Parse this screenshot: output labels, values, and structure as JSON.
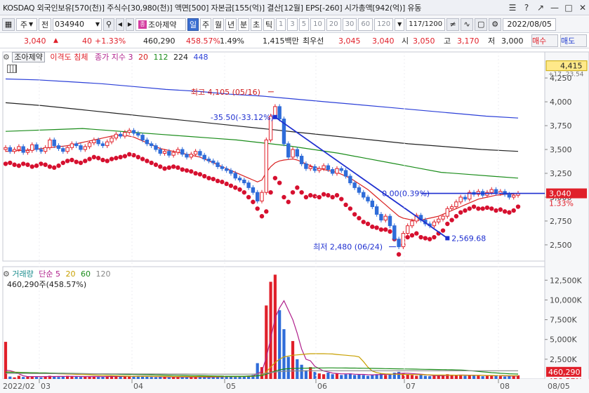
{
  "titlebar": {
    "info": "KOSDAQ 외국인보유[570(천)] 주식수[30,980(천)] 액면[500] 자본금[155(억)] 결산[12월] EPS[-260] 시가총액[942(억)] 유동",
    "icons": [
      "menu-icon",
      "help-icon",
      "popout-icon",
      "minimize-icon",
      "restore-icon",
      "close-icon"
    ]
  },
  "toolbar": {
    "market": "주",
    "scope": "전",
    "code": "034940",
    "name_badge": "종",
    "name": "조아제약",
    "periods": [
      "일",
      "주",
      "월",
      "년",
      "분",
      "초",
      "틱"
    ],
    "selected_period": "일",
    "intervals": [
      "1",
      "3",
      "5",
      "10",
      "20",
      "30",
      "60",
      "120"
    ],
    "count": "117/1200",
    "date": "2022/08/05"
  },
  "quote": {
    "price": "3,040",
    "change": "40",
    "change_pct": "+1.33%",
    "volume": "460,290",
    "volume_ratio": "458.57%",
    "turnover": "1.49%",
    "amount": "1,415백만",
    "priority_label": "최우선",
    "ask": "3,045",
    "bid": "3,040",
    "open_label": "시",
    "open": "3,050",
    "high_label": "고",
    "high": "3,170",
    "low_label": "저",
    "low": "3,000",
    "buy_label": "매수",
    "sell_label": "매도"
  },
  "price_panel": {
    "legend_name": "조아제약",
    "legend_indicator": "이격도 침체",
    "legend_ma": "종가 지수 3",
    "legend_ma_periods": [
      "20",
      "112",
      "224",
      "448"
    ],
    "top_price_tag": "4,415",
    "top_small_tag": "+17, 23.54",
    "yticks": [
      "4,250",
      "4,000",
      "3,750",
      "3,500",
      "3,250",
      "3,000",
      "2,750",
      "2,500"
    ],
    "current_price_tag": "3,040",
    "current_pct_tag": "1.33%",
    "ann_high": "최고 4,105 (05/16)",
    "ann_trend": "-35.50(-33.12%)",
    "ann_level": "0.00(0.39%)",
    "ann_low": "최저 2,480 (06/24)",
    "ann_target": "2,569.68"
  },
  "volume_panel": {
    "legend_name": "거래량",
    "legend_ma": "단순 5",
    "legend_ma_periods": [
      "20",
      "60",
      "120"
    ],
    "current_volume": "460,290주(458.57%)",
    "yticks": [
      "12,500K",
      "10,000K",
      "7,500K",
      "5,000K",
      "2,500K"
    ],
    "current_volume_tag": "460,290",
    "current_pct_tag": "458.57%"
  },
  "xaxis": {
    "labels": [
      "2022/02",
      "03",
      "04",
      "05",
      "06",
      "07",
      "08",
      "08/05"
    ]
  },
  "colors": {
    "up": "#e0202a",
    "down": "#2f6cd9",
    "ma20": "#d92020",
    "ma112": "#1a8c1a",
    "ma224": "#222222",
    "ma448": "#2b3fd8",
    "trend": "#1e2fd0",
    "oversold_dot": "#d6102f",
    "accent_tag": "#e0202a"
  },
  "chart_data": {
    "type": "candlestick",
    "price_range": [
      2330,
      4420
    ],
    "volume_range": [
      0,
      13500000
    ],
    "high": {
      "date": "05/16",
      "value": 4105
    },
    "low": {
      "date": "06/24",
      "value": 2480
    },
    "last": {
      "date": "08/05",
      "close": 3040,
      "open": 3050,
      "high": 3170,
      "low": 3000,
      "volume": 460290
    },
    "closes": [
      3520,
      3480,
      3500,
      3530,
      3470,
      3490,
      3550,
      3500,
      3480,
      3520,
      3600,
      3540,
      3510,
      3480,
      3520,
      3560,
      3540,
      3500,
      3530,
      3570,
      3600,
      3560,
      3540,
      3580,
      3620,
      3660,
      3640,
      3680,
      3700,
      3670,
      3650,
      3600,
      3560,
      3540,
      3500,
      3460,
      3480,
      3440,
      3470,
      3500,
      3450,
      3420,
      3450,
      3480,
      3440,
      3400,
      3380,
      3360,
      3320,
      3300,
      3280,
      3250,
      3200,
      3180,
      3150,
      3100,
      3050,
      2960,
      3050,
      3600,
      3850,
      3950,
      3820,
      3560,
      3420,
      3500,
      3430,
      3350,
      3300,
      3320,
      3280,
      3300,
      3330,
      3290,
      3250,
      3300,
      3280,
      3220,
      3150,
      3100,
      3050,
      3000,
      2960,
      2900,
      2820,
      2760,
      2800,
      2700,
      2560,
      2480,
      2620,
      2700,
      2750,
      2810,
      2760,
      2720,
      2700,
      2740,
      2770,
      2800,
      2880,
      2900,
      2950,
      3000,
      2980,
      3050,
      3030,
      3060,
      3020,
      3050,
      3080,
      3040,
      3060,
      3030,
      3000,
      3020,
      3040
    ],
    "ma20": [
      3480,
      3480,
      3485,
      3490,
      3490,
      3495,
      3500,
      3505,
      3510,
      3515,
      3520,
      3525,
      3530,
      3535,
      3540,
      3550,
      3560,
      3570,
      3580,
      3590,
      3600,
      3610,
      3620,
      3630,
      3640,
      3645,
      3650,
      3650,
      3640,
      3630,
      3610,
      3590,
      3570,
      3550,
      3530,
      3510,
      3500,
      3490,
      3480,
      3470,
      3460,
      3450,
      3440,
      3430,
      3420,
      3400,
      3380,
      3360,
      3340,
      3320,
      3300,
      3280,
      3260,
      3240,
      3220,
      3200,
      3180,
      3160,
      3180,
      3260,
      3320,
      3360,
      3380,
      3390,
      3395,
      3400,
      3390,
      3370,
      3350,
      3330,
      3310,
      3300,
      3290,
      3280,
      3270,
      3260,
      3240,
      3220,
      3200,
      3170,
      3140,
      3110,
      3080,
      3040,
      3000,
      2960,
      2920,
      2880,
      2840,
      2800,
      2780,
      2770,
      2760,
      2760,
      2760,
      2770,
      2780,
      2790,
      2800,
      2820,
      2840,
      2860,
      2880,
      2900,
      2920,
      2940,
      2960,
      2980,
      2990,
      3000,
      3010,
      3020,
      3025,
      3030,
      3030,
      3035,
      3040
    ],
    "ma112": [
      3690,
      3700,
      3710,
      3720,
      3700,
      3680,
      3660,
      3640,
      3620,
      3600,
      3570,
      3540,
      3500,
      3460,
      3410,
      3360,
      3310,
      3260,
      3240,
      3220,
      3200
    ],
    "ma224": [
      3990,
      3960,
      3920,
      3880,
      3840,
      3800,
      3760,
      3720,
      3680,
      3640,
      3600,
      3560,
      3530,
      3500,
      3480
    ],
    "ma448": [
      4240,
      4230,
      4210,
      4190,
      4160,
      4130,
      4110,
      4080,
      4060,
      4030,
      4000,
      3970,
      3940,
      3910,
      3880,
      3850,
      3830
    ],
    "oversold": [
      3350,
      3360,
      3340,
      3330,
      3350,
      3340,
      3320,
      3330,
      3350,
      3340,
      3320,
      3310,
      3330,
      3360,
      3380,
      3390,
      3370,
      3360,
      3380,
      3400,
      3420,
      3410,
      3390,
      3380,
      3400,
      3410,
      3420,
      3430,
      3450,
      3440,
      3420,
      3400,
      3380,
      3360,
      3340,
      3320,
      3300,
      3310,
      3320,
      3310,
      3290,
      3280,
      3270,
      3250,
      3240,
      3220,
      3200,
      3190,
      3170,
      3160,
      3140,
      3120,
      3100,
      3080,
      3050,
      3000,
      2950,
      2880,
      2800,
      2850,
      3050,
      3200,
      3150,
      3000,
      2950,
      3050,
      3100,
      3050,
      3000,
      3020,
      3010,
      3000,
      3030,
      3020,
      3000,
      3020,
      2980,
      2920,
      2880,
      2820,
      2780,
      2740,
      2720,
      2690,
      2680,
      2660,
      2660,
      2640,
      2560,
      2400,
      2500,
      2580,
      2600,
      2620,
      2580,
      2570,
      2560,
      2580,
      2620,
      2650,
      2720,
      2760,
      2800,
      2840,
      2860,
      2880,
      2900,
      2880,
      2880,
      2890,
      2880,
      2860,
      2870,
      2850,
      2840,
      2860,
      2900
    ],
    "volumes": [
      4700,
      300,
      200,
      400,
      250,
      300,
      350,
      250,
      200,
      300,
      400,
      350,
      250,
      300,
      400,
      350,
      300,
      250,
      300,
      350,
      300,
      250,
      280,
      350,
      400,
      350,
      300,
      280,
      350,
      300,
      400,
      350,
      300,
      250,
      220,
      300,
      250,
      200,
      250,
      300,
      220,
      200,
      250,
      300,
      250,
      220,
      200,
      250,
      300,
      350,
      400,
      300,
      250,
      300,
      350,
      400,
      500,
      2000,
      1500,
      9300,
      12300,
      13200,
      8700,
      6300,
      2800,
      4800,
      2500,
      1800,
      1100,
      1500,
      900,
      700,
      600,
      800,
      600,
      700,
      500,
      600,
      700,
      500,
      600,
      500,
      400,
      500,
      600,
      700,
      500,
      600,
      800,
      900,
      700,
      600,
      500,
      400,
      500,
      400,
      350,
      400,
      450,
      500,
      600,
      500,
      450,
      500,
      400,
      450,
      500,
      400,
      350,
      400,
      450,
      400,
      350,
      300,
      350,
      400,
      460
    ],
    "vol_ma5": [
      1100,
      1050,
      900,
      650,
      400,
      300,
      300,
      300,
      300,
      300,
      310,
      310,
      320,
      320,
      330,
      340,
      330,
      310,
      300,
      300,
      310,
      300,
      290,
      300,
      310,
      320,
      330,
      320,
      330,
      330,
      340,
      340,
      330,
      310,
      290,
      280,
      270,
      260,
      250,
      250,
      240,
      240,
      240,
      250,
      250,
      240,
      230,
      240,
      250,
      270,
      300,
      310,
      310,
      320,
      340,
      360,
      390,
      700,
      950,
      2700,
      5100,
      7700,
      9000,
      9900,
      8700,
      7500,
      5800,
      3800,
      2500,
      2300,
      1600,
      1300,
      1000,
      900,
      750,
      700,
      650,
      650,
      650,
      600,
      580,
      580,
      540,
      520,
      540,
      560,
      580,
      580,
      640,
      700,
      720,
      720,
      680,
      640,
      600,
      560,
      480,
      440,
      420,
      420,
      460,
      470,
      480,
      500,
      490,
      480,
      470,
      460,
      450,
      430,
      430,
      420,
      410,
      390,
      380,
      370,
      380
    ],
    "vol_ma20": [
      900,
      880,
      860,
      840,
      820,
      800,
      780,
      760,
      740,
      720,
      700,
      680,
      660,
      640,
      620,
      600,
      580,
      560,
      540,
      520,
      500,
      480,
      460,
      440,
      420,
      400,
      380,
      360,
      350,
      340,
      330,
      330,
      330,
      330,
      330,
      330,
      320,
      310,
      300,
      300,
      300,
      300,
      300,
      300,
      300,
      300,
      300,
      300,
      300,
      300,
      300,
      300,
      300,
      300,
      310,
      320,
      330,
      400,
      460,
      900,
      1500,
      2100,
      2500,
      2800,
      2900,
      3000,
      3050,
      3100,
      3150,
      3200,
      3200,
      3200,
      3200,
      3180,
      3160,
      3100,
      3050,
      3000,
      2950,
      2900,
      2800,
      2200,
      1500,
      1000,
      800,
      700,
      650,
      620,
      600,
      590,
      580,
      570,
      560,
      550,
      540,
      530,
      520,
      510,
      500,
      495,
      490,
      485,
      480,
      475,
      470,
      465,
      460,
      455,
      450,
      445,
      440,
      435,
      430,
      425,
      420,
      420,
      420
    ],
    "vol_ma60": [
      850,
      840,
      830,
      820,
      810,
      800,
      790,
      780,
      770,
      760,
      750,
      740,
      730,
      720,
      710,
      700,
      690,
      680,
      670,
      660,
      650,
      640,
      630,
      620,
      610,
      600,
      590,
      580,
      570,
      560,
      550,
      540,
      530,
      520,
      510,
      500,
      490,
      480,
      470,
      460,
      450,
      440,
      430,
      420,
      410,
      400,
      390,
      380,
      370,
      360,
      350,
      350,
      350,
      350,
      350,
      360,
      370,
      400,
      430,
      600,
      800,
      1000,
      1150,
      1250,
      1300,
      1330,
      1350,
      1360,
      1370,
      1380,
      1385,
      1390,
      1395,
      1400,
      1400,
      1395,
      1390,
      1385,
      1380,
      1375,
      1370,
      1360,
      1350,
      1340,
      1330,
      1320,
      1310,
      1300,
      1290,
      1280,
      1270,
      1260,
      1250,
      1240,
      1230,
      1220,
      1210,
      1200,
      1190,
      1180,
      1170,
      1160,
      1150,
      1140,
      1100,
      1050,
      1000,
      950,
      900,
      850,
      800,
      760,
      720,
      690,
      660,
      640,
      620
    ],
    "vol_ma120": [
      700,
      698,
      696,
      694,
      692,
      690,
      688,
      686,
      684,
      682,
      680,
      678,
      676,
      674,
      672,
      670,
      668,
      666,
      664,
      662,
      660,
      658,
      656,
      654,
      652,
      650,
      648,
      646,
      644,
      642,
      640,
      638,
      636,
      634,
      632,
      630,
      628,
      626,
      624,
      622,
      620,
      618,
      616,
      614,
      612,
      610,
      608,
      606,
      604,
      602,
      600,
      600,
      600,
      600,
      600,
      605,
      610,
      630,
      650,
      720,
      800,
      880,
      940,
      980,
      1000,
      1010,
      1020,
      1025,
      1030,
      1035,
      1040,
      1040,
      1040,
      1040,
      1040,
      1040,
      1040,
      1040,
      1040,
      1040,
      1040,
      1040,
      1040,
      1040,
      1040,
      1040,
      1040,
      1040,
      1040,
      1040,
      1040,
      1040,
      1040,
      1040,
      1040,
      1040,
      1040,
      1040,
      1040,
      1040,
      1040,
      1040,
      1040,
      1040,
      1040,
      1040,
      1040,
      1040,
      1040,
      1040,
      1040,
      1040,
      1040,
      1040,
      1040,
      1040,
      1040
    ]
  }
}
